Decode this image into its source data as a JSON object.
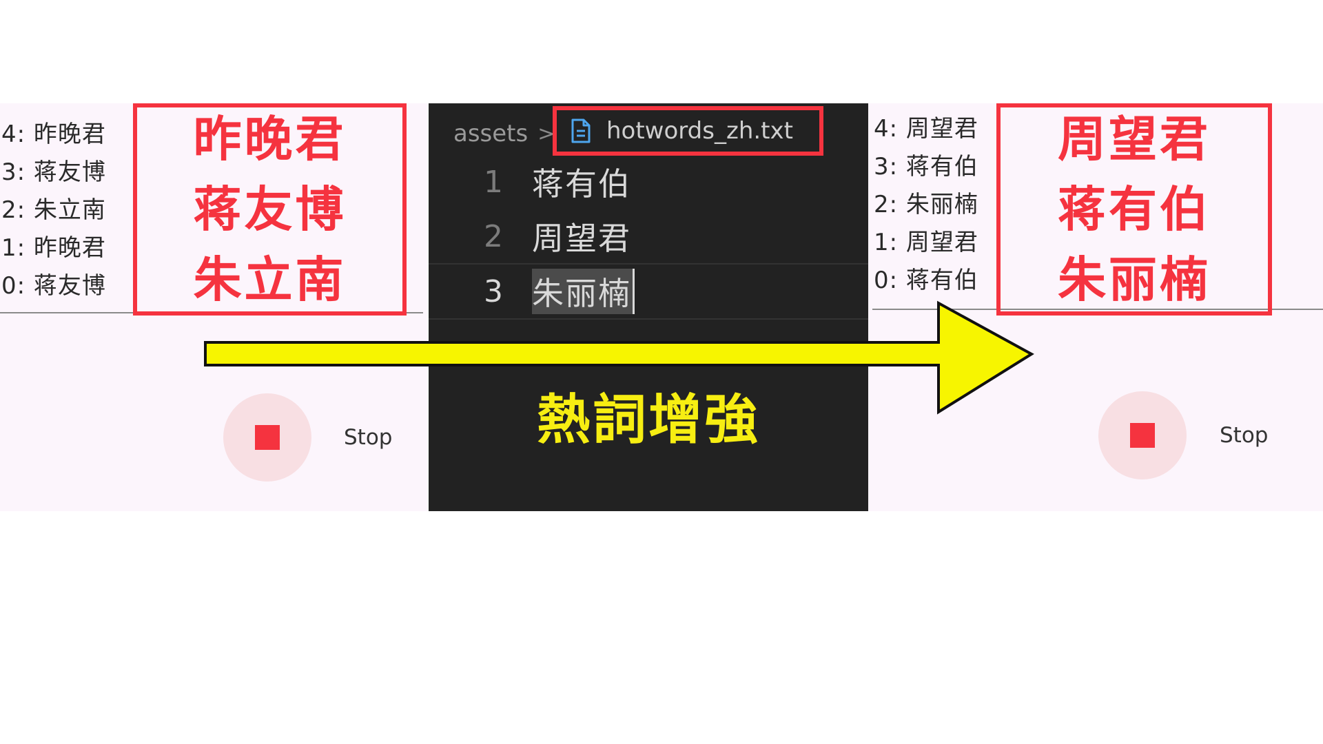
{
  "left_panel": {
    "results": [
      "4: 昨晚君",
      "3: 蒋友博",
      "2: 朱立南",
      "1: 昨晚君",
      "0: 蒋友博"
    ],
    "highlight_words": [
      "昨晚君",
      "蒋友博",
      "朱立南"
    ],
    "stop_label": "Stop"
  },
  "editor": {
    "breadcrumb_folder": "assets",
    "breadcrumb_separator": ">",
    "file_name": "hotwords_zh.txt",
    "lines": [
      {
        "number": "1",
        "text": "蒋有伯"
      },
      {
        "number": "2",
        "text": "周望君"
      },
      {
        "number": "3",
        "text": "朱丽楠"
      }
    ],
    "caption": "熱詞增強"
  },
  "right_panel": {
    "results": [
      "4: 周望君",
      "3: 蒋有伯",
      "2: 朱丽楠",
      "1: 周望君",
      "0: 蒋有伯"
    ],
    "highlight_words": [
      "周望君",
      "蒋有伯",
      "朱丽楠"
    ],
    "stop_label": "Stop"
  },
  "colors": {
    "highlight_red": "#f5333f",
    "arrow_yellow": "#f7f500",
    "caption_yellow": "#f7ee12",
    "editor_bg": "#222222",
    "panel_bg": "#fcf5fc",
    "file_icon_blue": "#4ea6ee"
  },
  "icons": {
    "stop": "stop-square-icon",
    "file": "file-document-icon",
    "arrow": "right-arrow-icon"
  }
}
